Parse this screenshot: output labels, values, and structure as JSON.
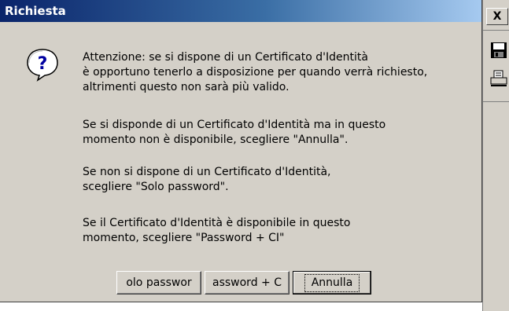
{
  "window": {
    "title": "Richiesta"
  },
  "icon": {
    "name": "question-icon"
  },
  "message": {
    "paragraph1": [
      "Attenzione: se si dispone di un Certificato d'Identità",
      "è opportuno tenerlo a disposizione per quando verrà richiesto,",
      "altrimenti questo non sarà più valido."
    ],
    "paragraph2": [
      "Se si disponde di un Certificato d'Identità ma in questo",
      "momento non è disponibile, scegliere \"Annulla\"."
    ],
    "paragraph3": [
      "Se non si dispone di un Certificato d'Identità,",
      "scegliere \"Solo password\"."
    ],
    "paragraph4": [
      "Se il Certificato d'Identità è disponibile in questo",
      "momento, scegliere \"Password + CI\""
    ]
  },
  "buttons": {
    "solo_password": "olo passwor",
    "password_ci": "assword + C",
    "annulla": "Annulla"
  },
  "side": {
    "close_label": "X"
  }
}
